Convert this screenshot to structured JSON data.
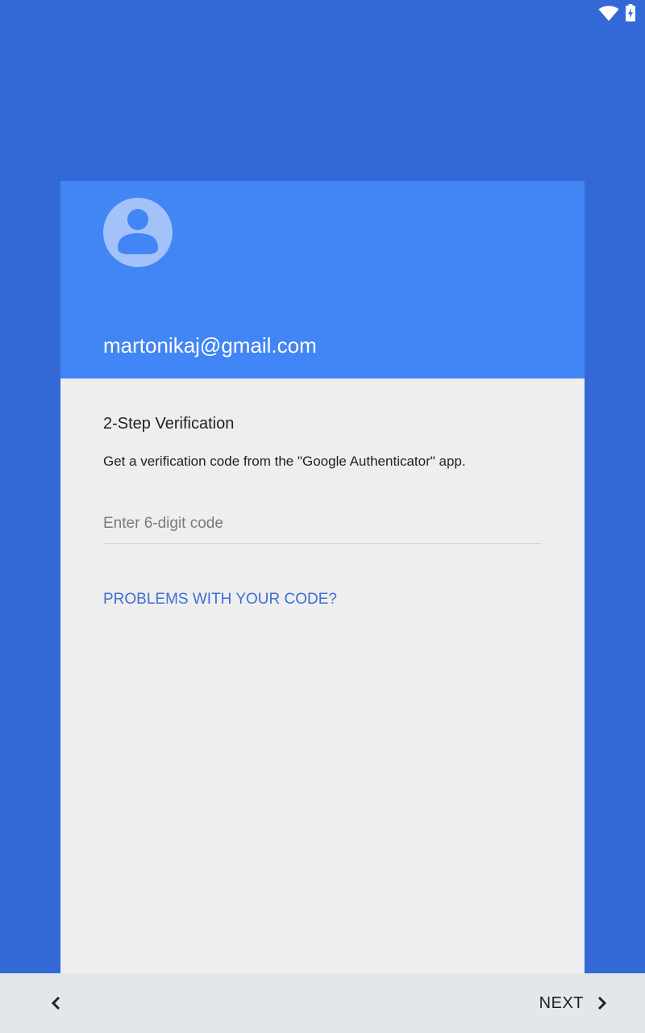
{
  "status_bar": {
    "icons": [
      "wifi-icon",
      "battery-charging-icon"
    ]
  },
  "colors": {
    "background": "#3369d6",
    "header": "#4285f4",
    "card": "#eeeeee",
    "link": "#3d6fd4",
    "nav_bar": "#e4e7ea"
  },
  "account": {
    "avatar_icon": "account-circle-icon",
    "email": "martonikaj@gmail.com"
  },
  "verification": {
    "title": "2-Step Verification",
    "description": "Get a verification code from the \"Google Authenticator\" app.",
    "code_input": {
      "value": "",
      "placeholder": "Enter 6-digit code"
    },
    "problems_link": "PROBLEMS WITH YOUR CODE?"
  },
  "navigation": {
    "back_icon": "chevron-left-icon",
    "next_label": "NEXT",
    "next_icon": "chevron-right-icon"
  }
}
